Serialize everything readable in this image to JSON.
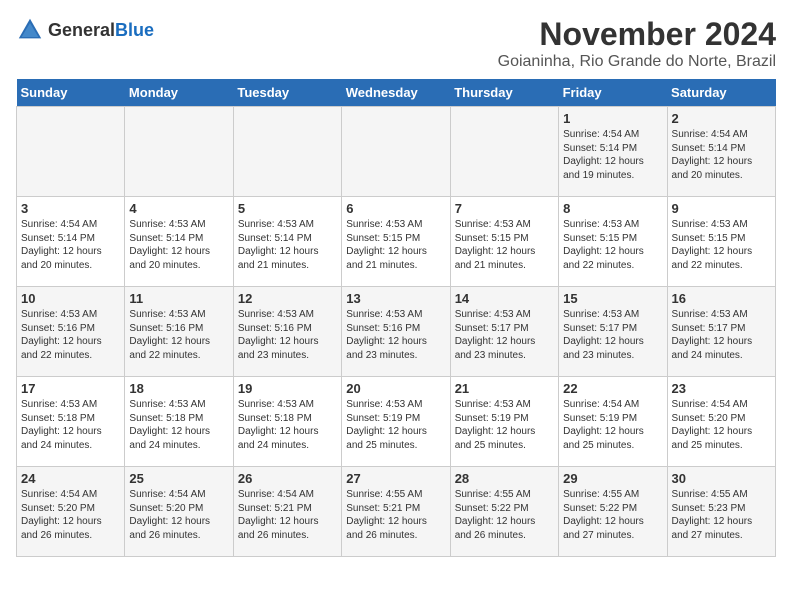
{
  "logo": {
    "general": "General",
    "blue": "Blue"
  },
  "header": {
    "month": "November 2024",
    "location": "Goianinha, Rio Grande do Norte, Brazil"
  },
  "weekdays": [
    "Sunday",
    "Monday",
    "Tuesday",
    "Wednesday",
    "Thursday",
    "Friday",
    "Saturday"
  ],
  "weeks": [
    [
      {
        "day": "",
        "content": ""
      },
      {
        "day": "",
        "content": ""
      },
      {
        "day": "",
        "content": ""
      },
      {
        "day": "",
        "content": ""
      },
      {
        "day": "",
        "content": ""
      },
      {
        "day": "1",
        "content": "Sunrise: 4:54 AM\nSunset: 5:14 PM\nDaylight: 12 hours and 19 minutes."
      },
      {
        "day": "2",
        "content": "Sunrise: 4:54 AM\nSunset: 5:14 PM\nDaylight: 12 hours and 20 minutes."
      }
    ],
    [
      {
        "day": "3",
        "content": "Sunrise: 4:54 AM\nSunset: 5:14 PM\nDaylight: 12 hours and 20 minutes."
      },
      {
        "day": "4",
        "content": "Sunrise: 4:53 AM\nSunset: 5:14 PM\nDaylight: 12 hours and 20 minutes."
      },
      {
        "day": "5",
        "content": "Sunrise: 4:53 AM\nSunset: 5:14 PM\nDaylight: 12 hours and 21 minutes."
      },
      {
        "day": "6",
        "content": "Sunrise: 4:53 AM\nSunset: 5:15 PM\nDaylight: 12 hours and 21 minutes."
      },
      {
        "day": "7",
        "content": "Sunrise: 4:53 AM\nSunset: 5:15 PM\nDaylight: 12 hours and 21 minutes."
      },
      {
        "day": "8",
        "content": "Sunrise: 4:53 AM\nSunset: 5:15 PM\nDaylight: 12 hours and 22 minutes."
      },
      {
        "day": "9",
        "content": "Sunrise: 4:53 AM\nSunset: 5:15 PM\nDaylight: 12 hours and 22 minutes."
      }
    ],
    [
      {
        "day": "10",
        "content": "Sunrise: 4:53 AM\nSunset: 5:16 PM\nDaylight: 12 hours and 22 minutes."
      },
      {
        "day": "11",
        "content": "Sunrise: 4:53 AM\nSunset: 5:16 PM\nDaylight: 12 hours and 22 minutes."
      },
      {
        "day": "12",
        "content": "Sunrise: 4:53 AM\nSunset: 5:16 PM\nDaylight: 12 hours and 23 minutes."
      },
      {
        "day": "13",
        "content": "Sunrise: 4:53 AM\nSunset: 5:16 PM\nDaylight: 12 hours and 23 minutes."
      },
      {
        "day": "14",
        "content": "Sunrise: 4:53 AM\nSunset: 5:17 PM\nDaylight: 12 hours and 23 minutes."
      },
      {
        "day": "15",
        "content": "Sunrise: 4:53 AM\nSunset: 5:17 PM\nDaylight: 12 hours and 23 minutes."
      },
      {
        "day": "16",
        "content": "Sunrise: 4:53 AM\nSunset: 5:17 PM\nDaylight: 12 hours and 24 minutes."
      }
    ],
    [
      {
        "day": "17",
        "content": "Sunrise: 4:53 AM\nSunset: 5:18 PM\nDaylight: 12 hours and 24 minutes."
      },
      {
        "day": "18",
        "content": "Sunrise: 4:53 AM\nSunset: 5:18 PM\nDaylight: 12 hours and 24 minutes."
      },
      {
        "day": "19",
        "content": "Sunrise: 4:53 AM\nSunset: 5:18 PM\nDaylight: 12 hours and 24 minutes."
      },
      {
        "day": "20",
        "content": "Sunrise: 4:53 AM\nSunset: 5:19 PM\nDaylight: 12 hours and 25 minutes."
      },
      {
        "day": "21",
        "content": "Sunrise: 4:53 AM\nSunset: 5:19 PM\nDaylight: 12 hours and 25 minutes."
      },
      {
        "day": "22",
        "content": "Sunrise: 4:54 AM\nSunset: 5:19 PM\nDaylight: 12 hours and 25 minutes."
      },
      {
        "day": "23",
        "content": "Sunrise: 4:54 AM\nSunset: 5:20 PM\nDaylight: 12 hours and 25 minutes."
      }
    ],
    [
      {
        "day": "24",
        "content": "Sunrise: 4:54 AM\nSunset: 5:20 PM\nDaylight: 12 hours and 26 minutes."
      },
      {
        "day": "25",
        "content": "Sunrise: 4:54 AM\nSunset: 5:20 PM\nDaylight: 12 hours and 26 minutes."
      },
      {
        "day": "26",
        "content": "Sunrise: 4:54 AM\nSunset: 5:21 PM\nDaylight: 12 hours and 26 minutes."
      },
      {
        "day": "27",
        "content": "Sunrise: 4:55 AM\nSunset: 5:21 PM\nDaylight: 12 hours and 26 minutes."
      },
      {
        "day": "28",
        "content": "Sunrise: 4:55 AM\nSunset: 5:22 PM\nDaylight: 12 hours and 26 minutes."
      },
      {
        "day": "29",
        "content": "Sunrise: 4:55 AM\nSunset: 5:22 PM\nDaylight: 12 hours and 27 minutes."
      },
      {
        "day": "30",
        "content": "Sunrise: 4:55 AM\nSunset: 5:23 PM\nDaylight: 12 hours and 27 minutes."
      }
    ]
  ]
}
